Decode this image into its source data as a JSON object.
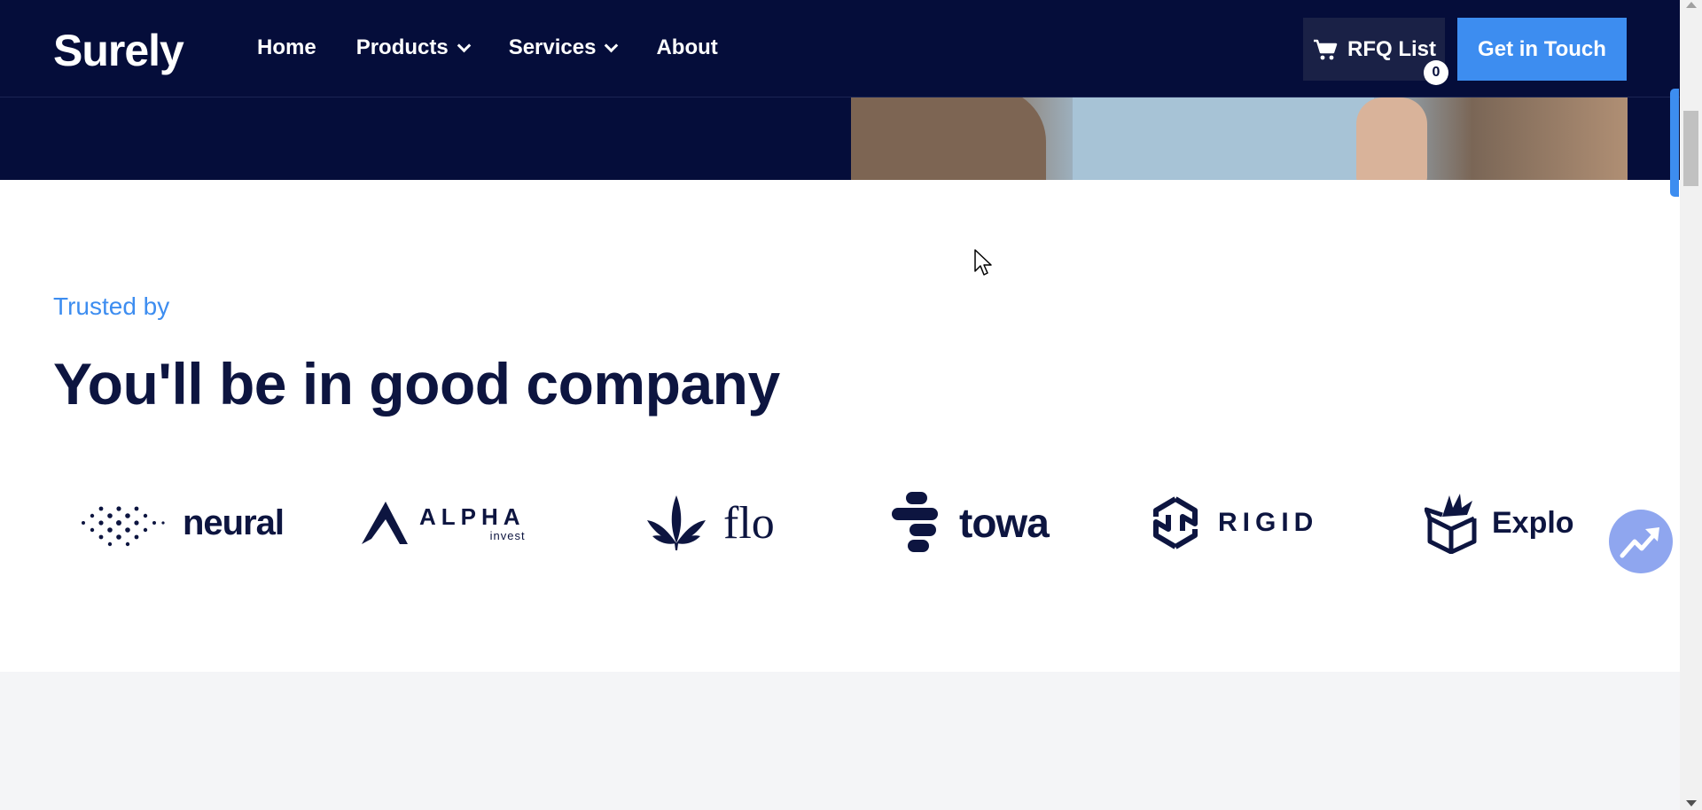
{
  "header": {
    "logo": "Surely",
    "nav": [
      {
        "label": "Home",
        "has_dropdown": false
      },
      {
        "label": "Products",
        "has_dropdown": true
      },
      {
        "label": "Services",
        "has_dropdown": true
      },
      {
        "label": "About",
        "has_dropdown": false
      }
    ],
    "rfq_label": "RFQ List",
    "rfq_count": "0",
    "cta_label": "Get in Touch"
  },
  "trusted": {
    "eyebrow": "Trusted by",
    "headline": "You'll be in good company",
    "logos": [
      {
        "name": "neural",
        "icon": "dot-grid-icon"
      },
      {
        "name": "ALPHA",
        "sub": "invest",
        "icon": "peak-icon"
      },
      {
        "name": "flo",
        "icon": "leaf-icon"
      },
      {
        "name": "towa",
        "icon": "stacked-pills-icon"
      },
      {
        "name": "RIGID",
        "icon": "hexagon-chain-icon"
      },
      {
        "name": "Explo",
        "icon": "exploding-box-icon"
      }
    ]
  },
  "colors": {
    "navy": "#050d3a",
    "accent_blue": "#3d8df0",
    "heading": "#0d1540",
    "fab": "#8fa6ef",
    "grey_band": "#f4f5f7"
  }
}
